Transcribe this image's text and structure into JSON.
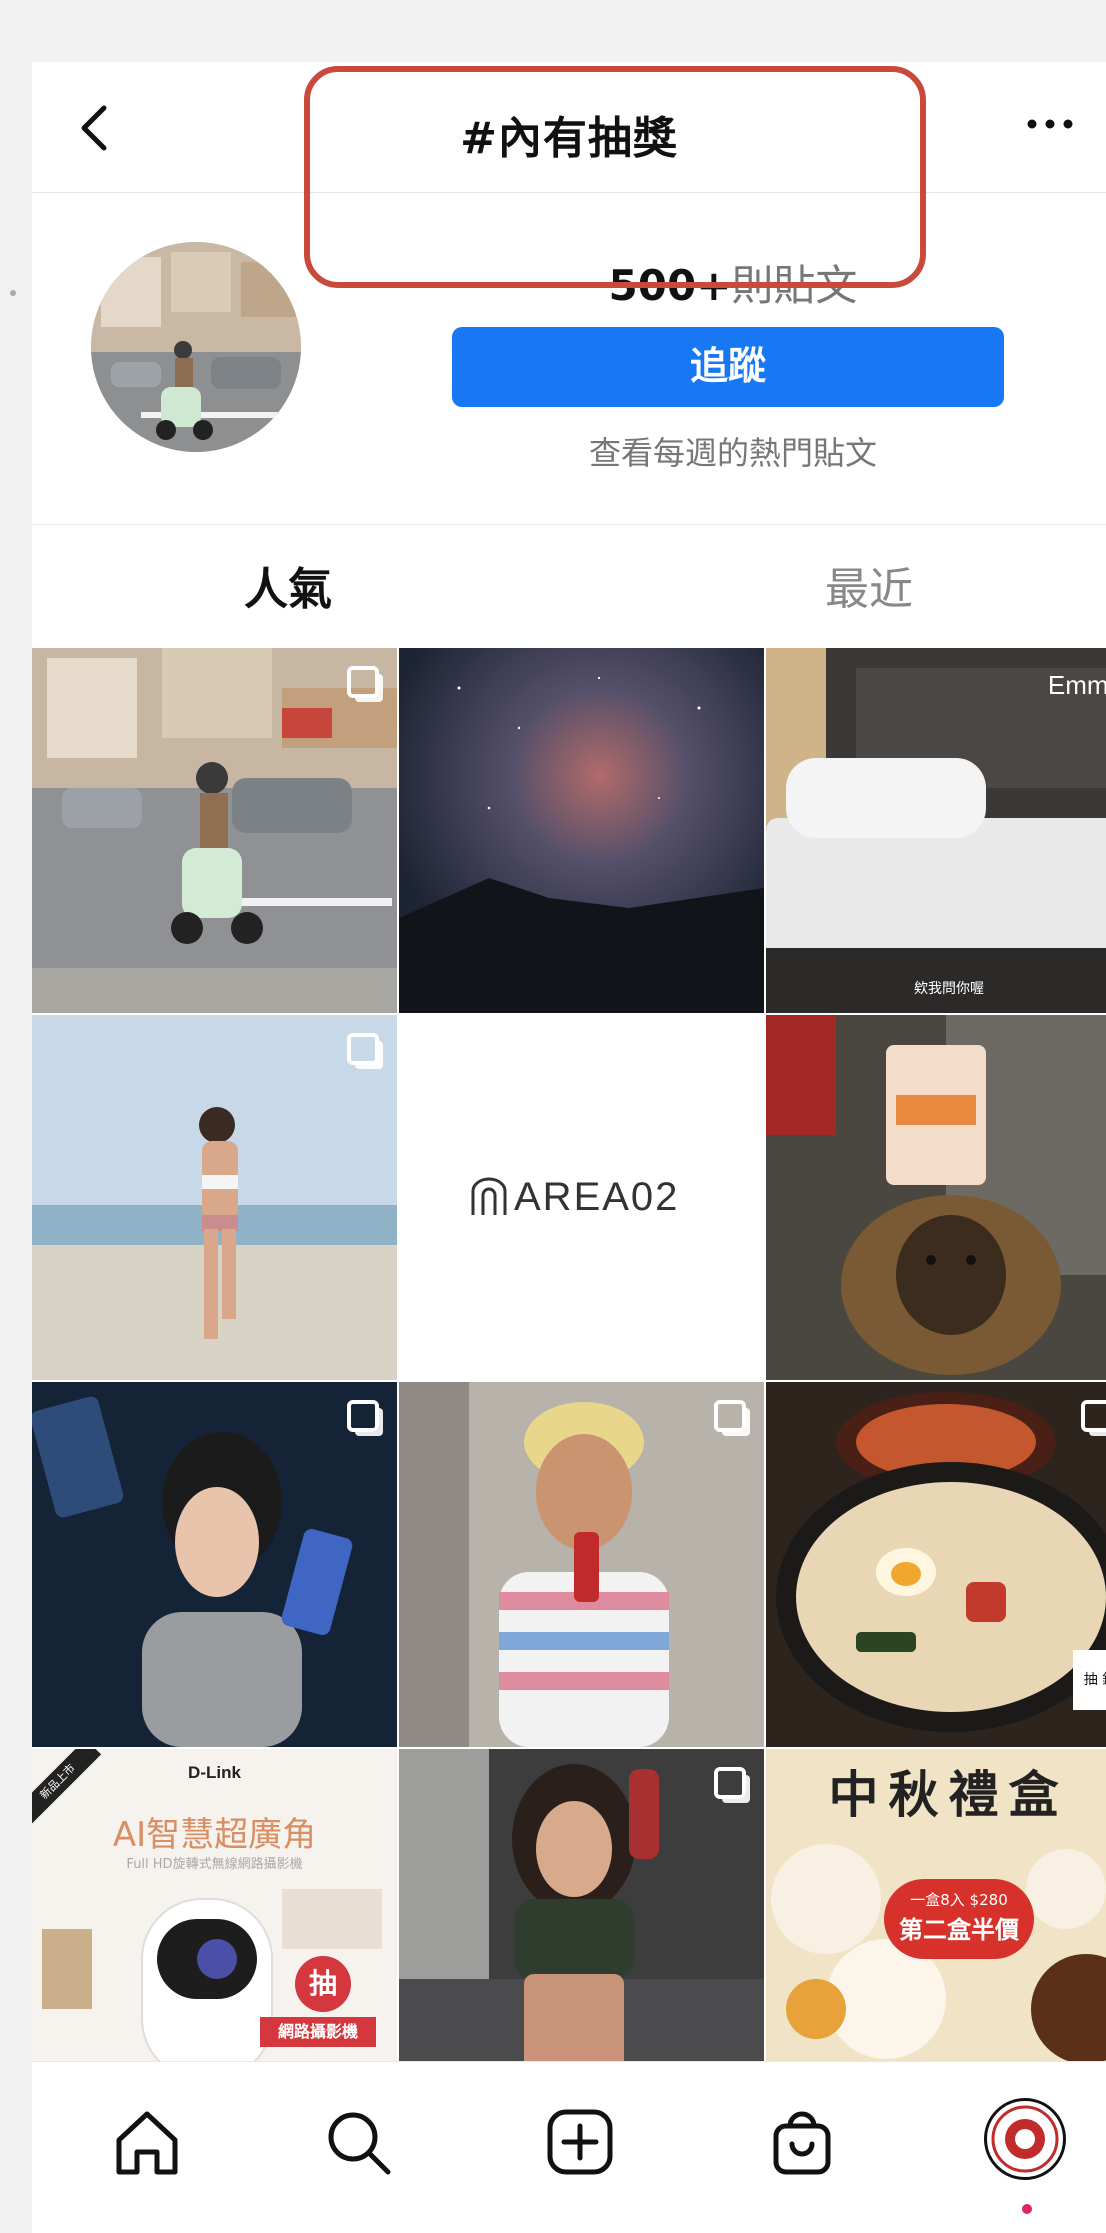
{
  "header": {
    "title": "#內有抽獎"
  },
  "profile": {
    "post_count": "500+",
    "post_count_suffix": "則貼文",
    "follow_label": "追蹤",
    "weekly_link": "查看每週的熱門貼文"
  },
  "tabs": [
    {
      "label": "人氣",
      "active": true
    },
    {
      "label": "最近",
      "active": false
    }
  ],
  "grid": {
    "tiles": [
      {
        "id": "scooter-street",
        "multiple": true
      },
      {
        "id": "night-sky-galaxy",
        "multiple": false
      },
      {
        "id": "emma-mattress",
        "multiple": false,
        "brand_text": "Emma",
        "caption": "欸我問你喔"
      },
      {
        "id": "beach-bikini",
        "multiple": true
      },
      {
        "id": "area02-logo",
        "multiple": false,
        "logo_text": "AREA02"
      },
      {
        "id": "dog-with-snack",
        "multiple": false
      },
      {
        "id": "phone-promo",
        "multiple": true
      },
      {
        "id": "blonde-guy-drink",
        "multiple": true
      },
      {
        "id": "ramen-bowl",
        "multiple": true,
        "label": "抽 鍋"
      },
      {
        "id": "dlink-camera",
        "multiple": false,
        "brand": "D-Link",
        "headline": "AI智慧超廣角",
        "subline": "Full HD旋轉式無線網路攝影機",
        "badge": "抽",
        "badge_caption": "網路攝影機",
        "corner_tag": "新品上市"
      },
      {
        "id": "fitness-woman",
        "multiple": true
      },
      {
        "id": "mooncake-promo",
        "multiple": false,
        "headline": "中秋禮盒",
        "deal": "一盒8入 $280",
        "deal2": "第二盒半價"
      }
    ]
  },
  "nav": {
    "items": [
      "home-icon",
      "search-icon",
      "new-post-icon",
      "shop-icon",
      "profile-avatar"
    ]
  }
}
